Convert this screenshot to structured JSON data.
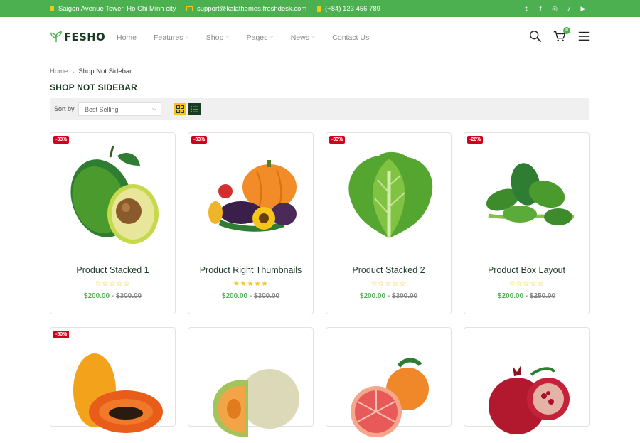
{
  "topbar": {
    "address": "Saigon Avenue Tower, Ho Chi Minh city",
    "email": "support@kalathemes.freshdesk.com",
    "phone": "(+84) 123 456 789",
    "socials": [
      {
        "icon": "twitter-icon",
        "glyph": "t"
      },
      {
        "icon": "facebook-icon",
        "glyph": "f"
      },
      {
        "icon": "instagram-icon",
        "glyph": "◎"
      },
      {
        "icon": "tiktok-icon",
        "glyph": "♪"
      },
      {
        "icon": "youtube-icon",
        "glyph": "▶"
      }
    ],
    "bg_color": "#4caf50",
    "icon_color": "#f5c518"
  },
  "header": {
    "logo_text": "FESHO",
    "nav": [
      {
        "label": "Home",
        "dropdown": false
      },
      {
        "label": "Features",
        "dropdown": true
      },
      {
        "label": "Shop",
        "dropdown": true
      },
      {
        "label": "Pages",
        "dropdown": true
      },
      {
        "label": "News",
        "dropdown": true
      },
      {
        "label": "Contact Us",
        "dropdown": false
      }
    ],
    "cart_count": "0"
  },
  "breadcrumb": {
    "home": "Home",
    "separator": "›",
    "current": "Shop Not Sidebar"
  },
  "page_title": "SHOP NOT SIDEBAR",
  "toolbar": {
    "sort_label": "Sort by",
    "sort_value": "Best Selling",
    "view_active": "grid"
  },
  "products": [
    {
      "name": "Product Stacked 1",
      "badge": "-33%",
      "rating": 0,
      "price": "$200.00",
      "old_price": "$300.00",
      "image": "avocado"
    },
    {
      "name": "Product Right Thumbnails",
      "badge": "-33%",
      "rating": 5,
      "price": "$200.00",
      "old_price": "$300.00",
      "image": "vegetables"
    },
    {
      "name": "Product Stacked 2",
      "badge": "-33%",
      "rating": 0,
      "price": "$200.00",
      "old_price": "$300.00",
      "image": "lettuce"
    },
    {
      "name": "Product Box Layout",
      "badge": "-20%",
      "rating": 0,
      "price": "$200.00",
      "old_price": "$250.00",
      "image": "spinach"
    },
    {
      "name": "",
      "badge": "-50%",
      "rating": 0,
      "price": "",
      "old_price": "",
      "image": "papaya"
    },
    {
      "name": "",
      "badge": "",
      "rating": 0,
      "price": "",
      "old_price": "",
      "image": "melon"
    },
    {
      "name": "",
      "badge": "",
      "rating": 0,
      "price": "",
      "old_price": "",
      "image": "grapefruit"
    },
    {
      "name": "",
      "badge": "",
      "rating": 0,
      "price": "",
      "old_price": "",
      "image": "pomegranate"
    }
  ],
  "colors": {
    "accent_green": "#4caf50",
    "dark_green": "#1d3b24",
    "badge_red": "#d0021b",
    "star_yellow": "#f5c518"
  }
}
